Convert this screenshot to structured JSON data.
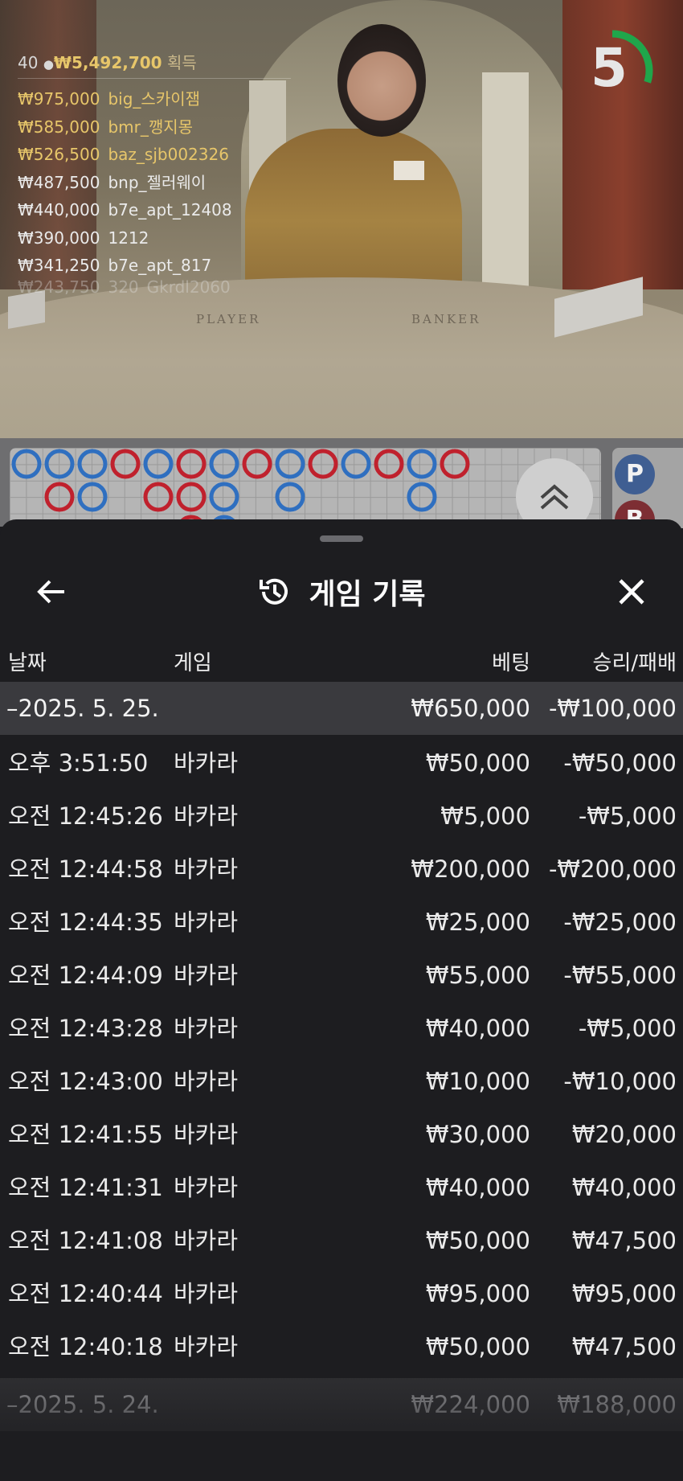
{
  "leaderboard": {
    "count": "40",
    "total": "₩5,492,700",
    "total_suffix": "획득",
    "rows": [
      {
        "amount": "₩975,000",
        "name": "big_스카이잼"
      },
      {
        "amount": "₩585,000",
        "name": "bmr_깽지몽"
      },
      {
        "amount": "₩526,500",
        "name": "baz_sjb002326"
      },
      {
        "amount": "₩487,500",
        "name": "bnp_젤러웨이"
      },
      {
        "amount": "₩440,000",
        "name": "b7e_apt_12408"
      },
      {
        "amount": "₩390,000",
        "name": "1212"
      },
      {
        "amount": "₩341,250",
        "name": "b7e_apt_817"
      },
      {
        "amount": "₩243,750",
        "name": "320_Gkrdl2060"
      }
    ]
  },
  "timer": {
    "value": "5",
    "remaining_fraction": 0.3,
    "color": "#1fa64b"
  },
  "table_labels": {
    "player": "PLAYER",
    "banker": "BANKER"
  },
  "roadmap": {
    "player_label": "P",
    "banker_label": "B",
    "player_color": "#2f6fc0",
    "banker_color": "#c0212d"
  },
  "sheet": {
    "title": "게임 기록",
    "columns": {
      "date": "날짜",
      "game": "게임",
      "bet": "베팅",
      "result": "승리/패배"
    },
    "groups": [
      {
        "date": "–2025. 5. 25.",
        "bet": "₩650,000",
        "result": "-₩100,000",
        "rows": [
          {
            "time": "오후 3:51:50",
            "game": "바카라",
            "bet": "₩50,000",
            "result": "-₩50,000"
          },
          {
            "time": "오전 12:45:26",
            "game": "바카라",
            "bet": "₩5,000",
            "result": "-₩5,000"
          },
          {
            "time": "오전 12:44:58",
            "game": "바카라",
            "bet": "₩200,000",
            "result": "-₩200,000"
          },
          {
            "time": "오전 12:44:35",
            "game": "바카라",
            "bet": "₩25,000",
            "result": "-₩25,000"
          },
          {
            "time": "오전 12:44:09",
            "game": "바카라",
            "bet": "₩55,000",
            "result": "-₩55,000"
          },
          {
            "time": "오전 12:43:28",
            "game": "바카라",
            "bet": "₩40,000",
            "result": "-₩5,000"
          },
          {
            "time": "오전 12:43:00",
            "game": "바카라",
            "bet": "₩10,000",
            "result": "-₩10,000"
          },
          {
            "time": "오전 12:41:55",
            "game": "바카라",
            "bet": "₩30,000",
            "result": "₩20,000"
          },
          {
            "time": "오전 12:41:31",
            "game": "바카라",
            "bet": "₩40,000",
            "result": "₩40,000"
          },
          {
            "time": "오전 12:41:08",
            "game": "바카라",
            "bet": "₩50,000",
            "result": "₩47,500"
          },
          {
            "time": "오전 12:40:44",
            "game": "바카라",
            "bet": "₩95,000",
            "result": "₩95,000"
          },
          {
            "time": "오전 12:40:18",
            "game": "바카라",
            "bet": "₩50,000",
            "result": "₩47,500"
          }
        ]
      },
      {
        "date": "–2025. 5. 24.",
        "bet": "₩224,000",
        "result": "₩188,000",
        "rows": []
      }
    ]
  }
}
